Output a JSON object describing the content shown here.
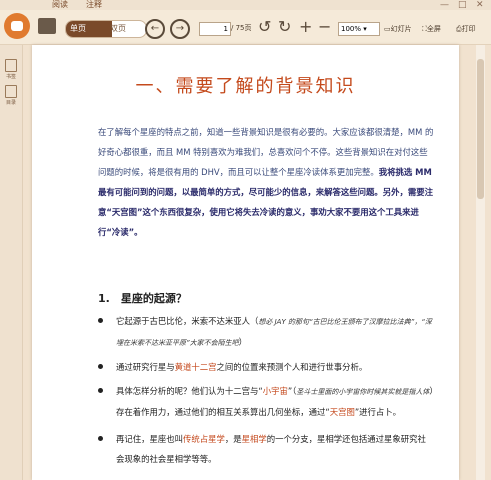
{
  "tabs": {
    "read": "阅读",
    "annotate": "注释"
  },
  "toolbar": {
    "single_page": "单页",
    "double_page": "双页",
    "page_current": "1",
    "page_total": "/ 75页",
    "zoom": "100%",
    "slideshow": "幻灯片",
    "fullscreen": "全屏",
    "print": "打印"
  },
  "sidebar": {
    "items": [
      {
        "label": "书签"
      },
      {
        "label": "目录"
      }
    ]
  },
  "doc": {
    "title": "一、需要了解的背景知识",
    "intro": "在了解每个星座的特点之前，知道一些背景知识是很有必要的。大家应该都很清楚，MM 的好奇心都很重，而且 MM 特别喜欢为难我们，总喜欢问个不停。这些背景知识在对付这些问题的时候，将是很有用的 DHV，而且可以让整个星座冷读体系更加完整。",
    "intro_bold": "我将挑选 MM 最有可能问到的问题，以最简单的方式，尽可能少的信息，来解答这些问题。另外，需要注意“天宫图”这个东西很复杂，使用它将失去冷读的意义，事劝大家不要用这个工具来进行“冷读”。",
    "section1": "1.　星座的起源？",
    "bullets": [
      {
        "pre": "它起源于古巴比伦，米索不达米亚人（",
        "it": "想必 JAY 的那句“古巴比伦王颁布了汉摩拉比法典”，“深埋在米索不达米亚平原”大家不会陌生吧",
        "post": "）"
      },
      {
        "pre": "通过研究行星与",
        "hl": "黄道十二宫",
        "post": "之间的位置来预测个人和进行世事分析。"
      },
      {
        "pre": "具体怎样分析的呢？他们认为十二宫与“",
        "hl": "小宇宙",
        "mid": "”（",
        "it": "圣斗士里面的小宇宙你时候其实就是指人体",
        "mid2": "）存在着作用力，通过他们的相互关系算出几何坐标，通过“",
        "hl2": "天宫图",
        "post": "”进行占卜。"
      },
      {
        "pre": "再记住，星座也叫",
        "hl": "传统占星学",
        "mid": "，是",
        "hl2": "星相学",
        "post": "的一个分支，星相学还包括通过星象研究社会现象的社会星相学等等。"
      }
    ]
  }
}
